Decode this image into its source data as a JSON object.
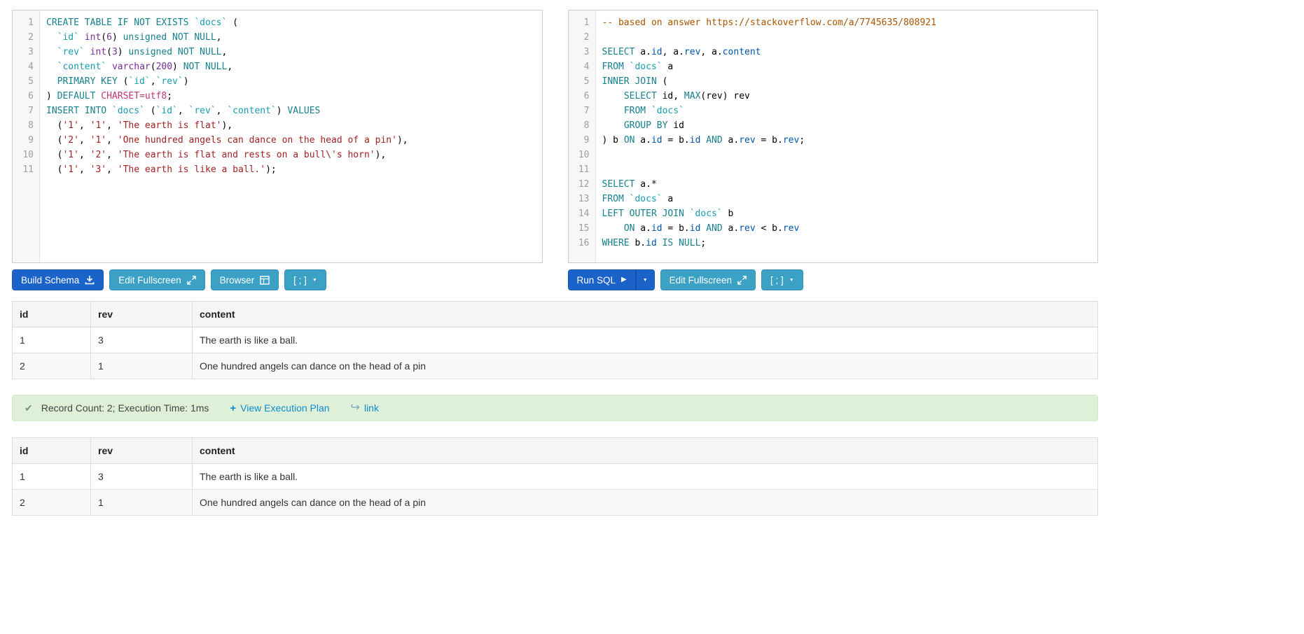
{
  "colors": {
    "primary": "#1b63c8",
    "primary_border": "#155bb5",
    "info": "#3ba1c5",
    "info_border": "#3391b2",
    "success_bg": "#dff0d8",
    "success_border": "#d6e9c6",
    "link": "#0e8cce"
  },
  "token_colors": {
    "kw": "#16818c",
    "id": "#189cb0",
    "ty": "#7b2d9b",
    "nu": "#7b2d9b",
    "st": "#a22222",
    "cm": "#aa5500",
    "vr": "#0055aa",
    "at": "#c2366b",
    "pl": "#000000"
  },
  "icons": {
    "caret": "▼",
    "play": "▶",
    "check": "✔",
    "plus": "+",
    "link_arrow": "↪"
  },
  "schema_toolbar": {
    "build_schema_label": "Build Schema",
    "edit_fullscreen_label": "Edit Fullscreen",
    "browser_label": "Browser",
    "terminator_label": "[ ; ]"
  },
  "query_toolbar": {
    "run_sql_label": "Run SQL",
    "edit_fullscreen_label": "Edit Fullscreen",
    "terminator_label": "[ ; ]"
  },
  "status_bar": {
    "message": "Record Count: 2; Execution Time: 1ms",
    "execution_plan_label": "View Execution Plan",
    "link_label": "link"
  },
  "schema_editor": {
    "lines": [
      {
        "num": "1",
        "tokens": [
          [
            "CREATE TABLE IF NOT EXISTS ",
            "kw"
          ],
          [
            "`docs`",
            "id"
          ],
          [
            " (",
            "pl"
          ]
        ]
      },
      {
        "num": "2",
        "tokens": [
          [
            "  ",
            "pl"
          ],
          [
            "`id`",
            "id"
          ],
          [
            " ",
            "pl"
          ],
          [
            "int",
            "ty"
          ],
          [
            "(",
            "pl"
          ],
          [
            "6",
            "nu"
          ],
          [
            ") ",
            "pl"
          ],
          [
            "unsigned NOT NULL",
            "kw"
          ],
          [
            ",",
            "pl"
          ]
        ]
      },
      {
        "num": "3",
        "tokens": [
          [
            "  ",
            "pl"
          ],
          [
            "`rev`",
            "id"
          ],
          [
            " ",
            "pl"
          ],
          [
            "int",
            "ty"
          ],
          [
            "(",
            "pl"
          ],
          [
            "3",
            "nu"
          ],
          [
            ") ",
            "pl"
          ],
          [
            "unsigned NOT NULL",
            "kw"
          ],
          [
            ",",
            "pl"
          ]
        ]
      },
      {
        "num": "4",
        "tokens": [
          [
            "  ",
            "pl"
          ],
          [
            "`content`",
            "id"
          ],
          [
            " ",
            "pl"
          ],
          [
            "varchar",
            "ty"
          ],
          [
            "(",
            "pl"
          ],
          [
            "200",
            "nu"
          ],
          [
            ") ",
            "pl"
          ],
          [
            "NOT NULL",
            "kw"
          ],
          [
            ",",
            "pl"
          ]
        ]
      },
      {
        "num": "5",
        "tokens": [
          [
            "  ",
            "pl"
          ],
          [
            "PRIMARY KEY",
            "kw"
          ],
          [
            " (",
            "pl"
          ],
          [
            "`id`",
            "id"
          ],
          [
            ",",
            "pl"
          ],
          [
            "`rev`",
            "id"
          ],
          [
            ")",
            "pl"
          ]
        ]
      },
      {
        "num": "6",
        "tokens": [
          [
            ") ",
            "pl"
          ],
          [
            "DEFAULT",
            "kw"
          ],
          [
            " ",
            "pl"
          ],
          [
            "CHARSET=utf8",
            "at"
          ],
          [
            ";",
            "pl"
          ]
        ]
      },
      {
        "num": "7",
        "tokens": [
          [
            "INSERT INTO ",
            "kw"
          ],
          [
            "`docs`",
            "id"
          ],
          [
            " (",
            "pl"
          ],
          [
            "`id`",
            "id"
          ],
          [
            ", ",
            "pl"
          ],
          [
            "`rev`",
            "id"
          ],
          [
            ", ",
            "pl"
          ],
          [
            "`content`",
            "id"
          ],
          [
            ") ",
            "pl"
          ],
          [
            "VALUES",
            "kw"
          ]
        ]
      },
      {
        "num": "8",
        "tokens": [
          [
            "  (",
            "pl"
          ],
          [
            "'1'",
            "st"
          ],
          [
            ", ",
            "pl"
          ],
          [
            "'1'",
            "st"
          ],
          [
            ", ",
            "pl"
          ],
          [
            "'The earth is flat'",
            "st"
          ],
          [
            "),",
            "pl"
          ]
        ]
      },
      {
        "num": "9",
        "tokens": [
          [
            "  (",
            "pl"
          ],
          [
            "'2'",
            "st"
          ],
          [
            ", ",
            "pl"
          ],
          [
            "'1'",
            "st"
          ],
          [
            ", ",
            "pl"
          ],
          [
            "'One hundred angels can dance on the head of a pin'",
            "st"
          ],
          [
            "),",
            "pl"
          ]
        ]
      },
      {
        "num": "10",
        "tokens": [
          [
            "  (",
            "pl"
          ],
          [
            "'1'",
            "st"
          ],
          [
            ", ",
            "pl"
          ],
          [
            "'2'",
            "st"
          ],
          [
            ", ",
            "pl"
          ],
          [
            "'The earth is flat and rests on a bull\\'s horn'",
            "st"
          ],
          [
            "),",
            "pl"
          ]
        ]
      },
      {
        "num": "11",
        "tokens": [
          [
            "  (",
            "pl"
          ],
          [
            "'1'",
            "st"
          ],
          [
            ", ",
            "pl"
          ],
          [
            "'3'",
            "st"
          ],
          [
            ", ",
            "pl"
          ],
          [
            "'The earth is like a ball.'",
            "st"
          ],
          [
            ");",
            "pl"
          ]
        ]
      }
    ]
  },
  "query_editor": {
    "lines": [
      {
        "num": "1",
        "tokens": [
          [
            "-- based on answer https://stackoverflow.com/a/7745635/808921",
            "cm"
          ]
        ]
      },
      {
        "num": "2",
        "tokens": []
      },
      {
        "num": "3",
        "tokens": [
          [
            "SELECT",
            "kw"
          ],
          [
            " a.",
            "pl"
          ],
          [
            "id",
            "vr"
          ],
          [
            ", a.",
            "pl"
          ],
          [
            "rev",
            "vr"
          ],
          [
            ", a.",
            "pl"
          ],
          [
            "content",
            "vr"
          ]
        ]
      },
      {
        "num": "4",
        "tokens": [
          [
            "FROM ",
            "kw"
          ],
          [
            "`docs`",
            "id"
          ],
          [
            " a",
            "pl"
          ]
        ]
      },
      {
        "num": "5",
        "tokens": [
          [
            "INNER JOIN",
            "kw"
          ],
          [
            " (",
            "pl"
          ]
        ]
      },
      {
        "num": "6",
        "tokens": [
          [
            "    ",
            "pl"
          ],
          [
            "SELECT",
            "kw"
          ],
          [
            " id, ",
            "pl"
          ],
          [
            "MAX",
            "kw"
          ],
          [
            "(rev) rev",
            "pl"
          ]
        ]
      },
      {
        "num": "7",
        "tokens": [
          [
            "    ",
            "pl"
          ],
          [
            "FROM ",
            "kw"
          ],
          [
            "`docs`",
            "id"
          ]
        ]
      },
      {
        "num": "8",
        "tokens": [
          [
            "    ",
            "pl"
          ],
          [
            "GROUP BY",
            "kw"
          ],
          [
            " id",
            "pl"
          ]
        ]
      },
      {
        "num": "9",
        "tokens": [
          [
            ") b ",
            "pl"
          ],
          [
            "ON",
            "kw"
          ],
          [
            " a.",
            "pl"
          ],
          [
            "id",
            "vr"
          ],
          [
            " = b.",
            "pl"
          ],
          [
            "id",
            "vr"
          ],
          [
            " ",
            "pl"
          ],
          [
            "AND",
            "kw"
          ],
          [
            " a.",
            "pl"
          ],
          [
            "rev",
            "vr"
          ],
          [
            " = b.",
            "pl"
          ],
          [
            "rev",
            "vr"
          ],
          [
            ";",
            "pl"
          ]
        ]
      },
      {
        "num": "10",
        "tokens": []
      },
      {
        "num": "11",
        "tokens": []
      },
      {
        "num": "12",
        "tokens": [
          [
            "SELECT",
            "kw"
          ],
          [
            " a.*",
            "pl"
          ]
        ]
      },
      {
        "num": "13",
        "tokens": [
          [
            "FROM ",
            "kw"
          ],
          [
            "`docs`",
            "id"
          ],
          [
            " a",
            "pl"
          ]
        ]
      },
      {
        "num": "14",
        "tokens": [
          [
            "LEFT OUTER JOIN ",
            "kw"
          ],
          [
            "`docs`",
            "id"
          ],
          [
            " b",
            "pl"
          ]
        ]
      },
      {
        "num": "15",
        "tokens": [
          [
            "    ",
            "pl"
          ],
          [
            "ON",
            "kw"
          ],
          [
            " a.",
            "pl"
          ],
          [
            "id",
            "vr"
          ],
          [
            " = b.",
            "pl"
          ],
          [
            "id",
            "vr"
          ],
          [
            " ",
            "pl"
          ],
          [
            "AND",
            "kw"
          ],
          [
            " a.",
            "pl"
          ],
          [
            "rev",
            "vr"
          ],
          [
            " < b.",
            "pl"
          ],
          [
            "rev",
            "vr"
          ]
        ]
      },
      {
        "num": "16",
        "tokens": [
          [
            "WHERE",
            "kw"
          ],
          [
            " b.",
            "pl"
          ],
          [
            "id",
            "vr"
          ],
          [
            " ",
            "pl"
          ],
          [
            "IS NULL",
            "kw"
          ],
          [
            ";",
            "pl"
          ]
        ]
      }
    ]
  },
  "result_tables": [
    {
      "columns": [
        "id",
        "rev",
        "content"
      ],
      "rows": [
        [
          "1",
          "3",
          "The earth is like a ball."
        ],
        [
          "2",
          "1",
          "One hundred angels can dance on the head of a pin"
        ]
      ]
    },
    {
      "columns": [
        "id",
        "rev",
        "content"
      ],
      "rows": [
        [
          "1",
          "3",
          "The earth is like a ball."
        ],
        [
          "2",
          "1",
          "One hundred angels can dance on the head of a pin"
        ]
      ]
    }
  ]
}
